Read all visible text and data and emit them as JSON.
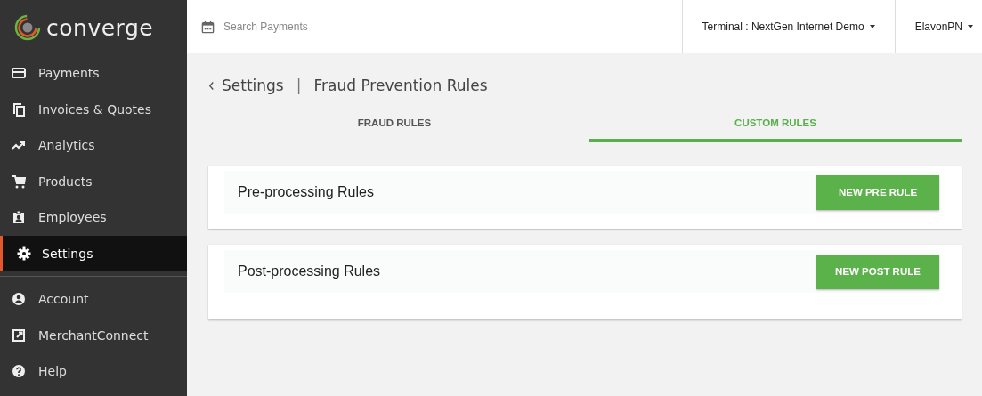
{
  "logo": {
    "text": "converge"
  },
  "sidebar": {
    "items": [
      {
        "kind": "card",
        "label": "Payments",
        "selected": false
      },
      {
        "kind": "copy",
        "label": "Invoices & Quotes",
        "selected": false
      },
      {
        "kind": "trend",
        "label": "Analytics",
        "selected": false
      },
      {
        "kind": "cart",
        "label": "Products",
        "selected": false
      },
      {
        "kind": "badge",
        "label": "Employees",
        "selected": false
      },
      {
        "kind": "gear",
        "label": "Settings",
        "selected": true
      }
    ],
    "bottom_items": [
      {
        "kind": "person",
        "label": "Account",
        "selected": false
      },
      {
        "kind": "external",
        "label": "MerchantConnect",
        "selected": false
      },
      {
        "kind": "help",
        "label": "Help",
        "selected": false
      }
    ]
  },
  "top_bar": {
    "search": {
      "placeholder": "Search Payments"
    },
    "terminal": "Terminal : NextGen Internet Demo",
    "user": "ElavonPN"
  },
  "breadcrumb": {
    "back": "Settings",
    "separator": "|",
    "current": "Fraud Prevention Rules"
  },
  "tabs": [
    {
      "label": "FRAUD RULES",
      "selected": false
    },
    {
      "label": "CUSTOM RULES",
      "selected": true
    }
  ],
  "cards": [
    {
      "title": "Pre-processing Rules",
      "button": "NEW PRE RULE"
    },
    {
      "title": "Post-processing Rules",
      "button": "NEW POST RULE"
    }
  ]
}
